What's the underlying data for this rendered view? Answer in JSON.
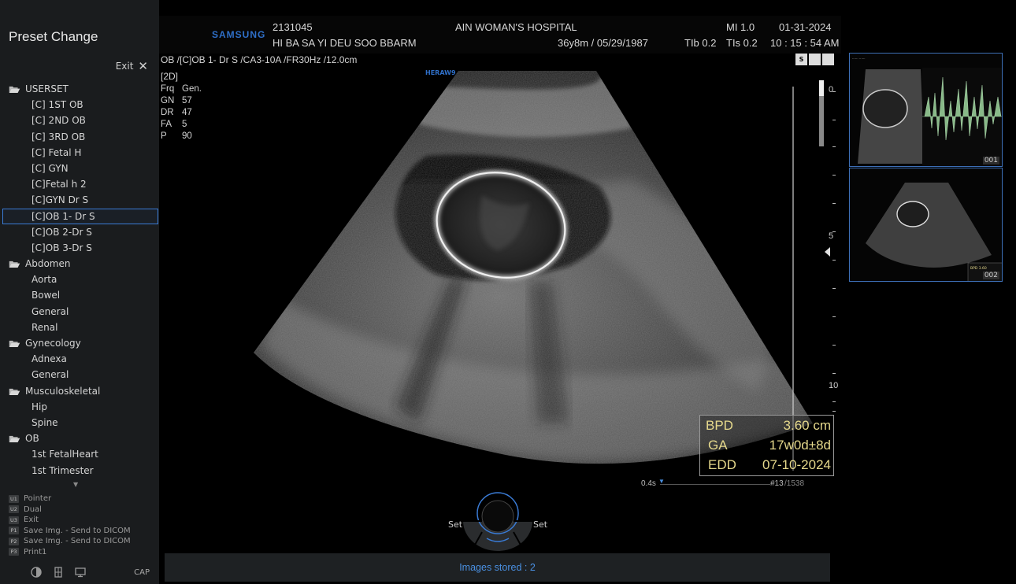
{
  "panel": {
    "title": "Preset Change",
    "exit_label": "Exit",
    "tree": [
      {
        "type": "folder",
        "label": "USERSET"
      },
      {
        "type": "item",
        "label": "[C] 1ST OB"
      },
      {
        "type": "item",
        "label": "[C] 2ND OB"
      },
      {
        "type": "item",
        "label": "[C] 3RD OB"
      },
      {
        "type": "item",
        "label": "[C] Fetal H"
      },
      {
        "type": "item",
        "label": "[C] GYN"
      },
      {
        "type": "item",
        "label": "[C]Fetal h 2"
      },
      {
        "type": "item",
        "label": "[C]GYN Dr S"
      },
      {
        "type": "item",
        "label": "[C]OB 1- Dr S",
        "selected": true
      },
      {
        "type": "item",
        "label": "[C]OB 2-Dr S"
      },
      {
        "type": "item",
        "label": "[C]OB 3-Dr S"
      },
      {
        "type": "folder",
        "label": "Abdomen"
      },
      {
        "type": "item",
        "label": "Aorta"
      },
      {
        "type": "item",
        "label": "Bowel"
      },
      {
        "type": "item",
        "label": "General"
      },
      {
        "type": "item",
        "label": "Renal"
      },
      {
        "type": "folder",
        "label": "Gynecology"
      },
      {
        "type": "item",
        "label": "Adnexa"
      },
      {
        "type": "item",
        "label": "General"
      },
      {
        "type": "folder",
        "label": "Musculoskeletal"
      },
      {
        "type": "item",
        "label": "Hip"
      },
      {
        "type": "item",
        "label": "Spine"
      },
      {
        "type": "folder",
        "label": "OB"
      },
      {
        "type": "item",
        "label": "1st FetalHeart"
      },
      {
        "type": "item",
        "label": "1st Trimester"
      }
    ],
    "shortcuts": [
      {
        "key": "U1",
        "label": "Pointer"
      },
      {
        "key": "U2",
        "label": "Dual"
      },
      {
        "key": "U3",
        "label": "Exit"
      },
      {
        "key": "P1",
        "label": "Save Img. - Send to DICOM"
      },
      {
        "key": "P2",
        "label": "Save Img. - Send to DICOM"
      },
      {
        "key": "P3",
        "label": "Print1"
      }
    ],
    "cap_label": "CAP"
  },
  "header": {
    "logo": "SAMSUNG",
    "patient_id": "2131045",
    "patient_name": "HI BA SA YI DEU SOO BBARM",
    "hospital": "AIN WOMAN'S HOSPITAL",
    "age_dob": "36y8m / 05/29/1987",
    "mi": "MI  1.0",
    "tib": "TIb 0.2",
    "tis": "TIs 0.2",
    "date": "01-31-2024",
    "time": "10 : 15 : 54 AM"
  },
  "imaging": {
    "info_line": "OB /[C]OB 1- Dr S /CA3-10A /FR30Hz /12.0cm",
    "mode": "[2D]",
    "probe_tag": "HERAW9",
    "params": [
      {
        "k": "Frq",
        "v": "Gen."
      },
      {
        "k": "GN",
        "v": "57"
      },
      {
        "k": "DR",
        "v": "47"
      },
      {
        "k": "FA",
        "v": "5"
      },
      {
        "k": "P",
        "v": "90"
      }
    ],
    "depth_labels": [
      "0",
      "5",
      "10"
    ]
  },
  "measurements": {
    "bpd_label": "BPD",
    "bpd_value": "3.60  cm",
    "ga_label": "GA",
    "ga_value": "17w0d±8d",
    "edd_label": "EDD",
    "edd_value": "07-10-2024"
  },
  "cine": {
    "time": "0.4s",
    "frame": "#13",
    "total": "/1538"
  },
  "controls": {
    "set_left": "Set",
    "set_right": "Set"
  },
  "status": {
    "text": "Images stored : 2"
  },
  "thumbnails": [
    {
      "num": "001"
    },
    {
      "num": "002"
    }
  ],
  "colors": {
    "accent": "#3a7bd5",
    "measurement_text": "#e6d98c",
    "status_text": "#4a90e2"
  }
}
